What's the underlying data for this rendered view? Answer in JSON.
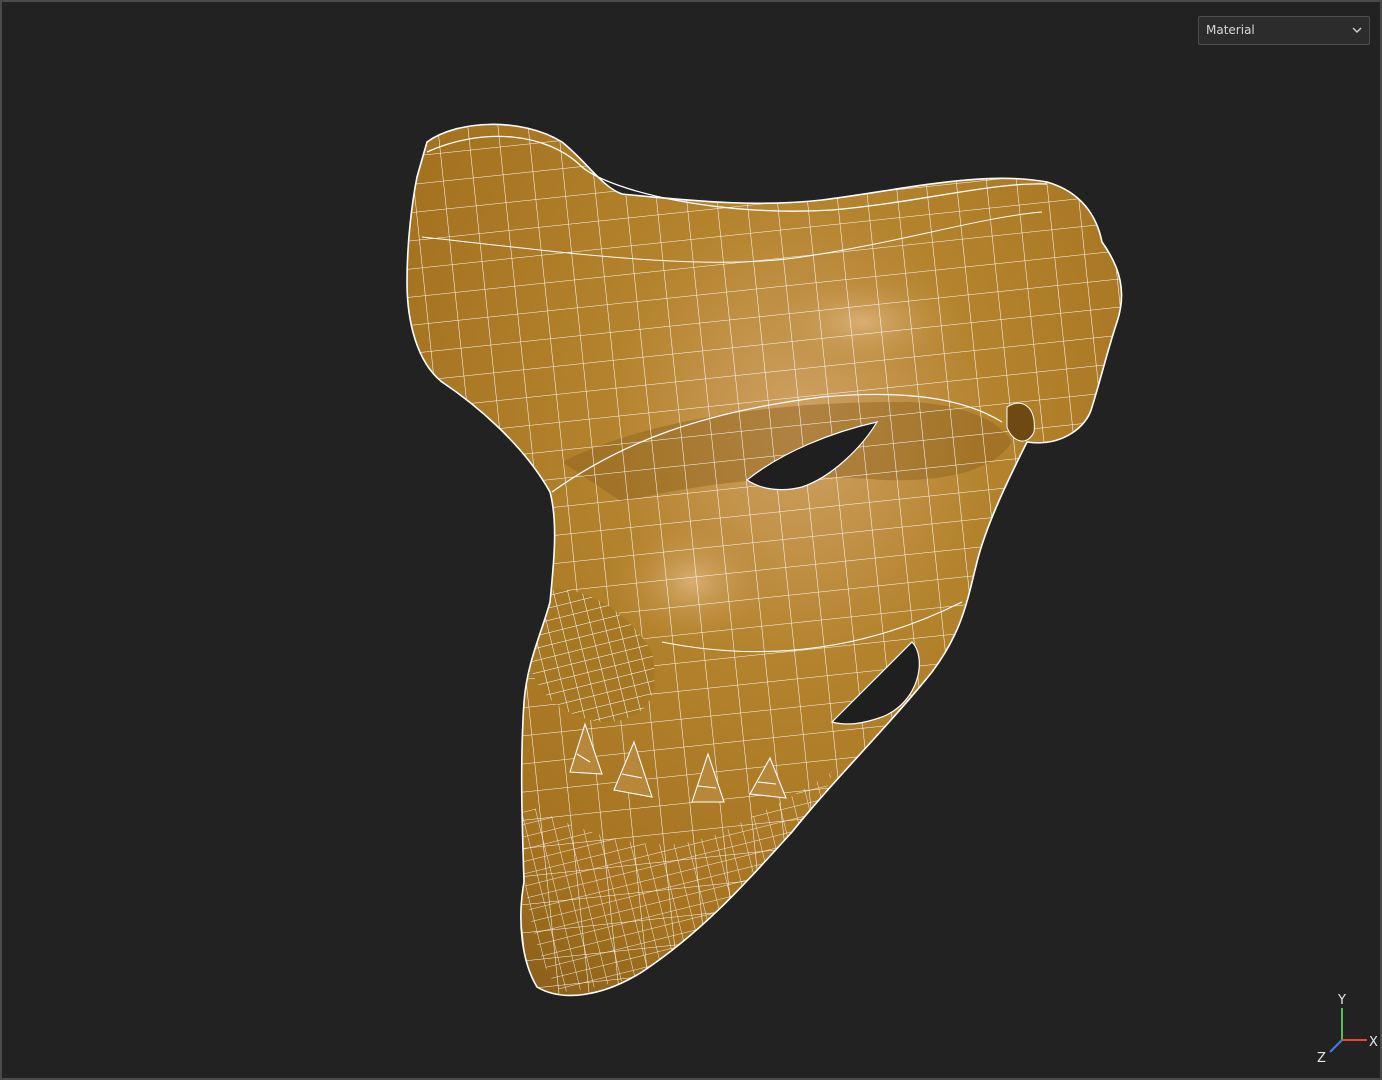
{
  "viewport": {
    "background": "#222222",
    "shading_mode": {
      "selected": "Material"
    },
    "model": {
      "icon": "wireframe-mask-mesh",
      "surface_color": "#b4832d",
      "wire_color": "#ffffff"
    },
    "axis_gizmo": {
      "x_label": "X",
      "y_label": "Y",
      "z_label": "Z",
      "x_color": "#e24a3e",
      "y_color": "#4fc34f",
      "z_color": "#4a7ae0"
    }
  }
}
